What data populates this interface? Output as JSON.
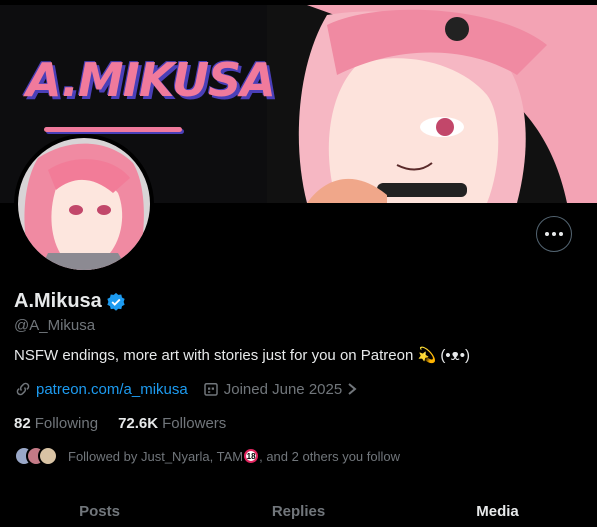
{
  "banner": {
    "logo_text": "A.MIKUSA"
  },
  "profile": {
    "display_name": "A.Mikusa",
    "handle": "@A_Mikusa",
    "bio": "NSFW endings, more art with stories  just for you on Patreon 💫 (•ᴥ•)",
    "link": "patreon.com/a_mikusa",
    "joined": "Joined June 2025",
    "following_count": "82",
    "following_label": "Following",
    "followers_count": "72.6K",
    "followers_label": "Followers",
    "followed_by_prefix": "Followed by Just_Nyarla, TAM",
    "followed_by_badge": "18",
    "followed_by_suffix": ", and 2 others you follow"
  },
  "tabs": [
    {
      "label": "Posts",
      "active": false
    },
    {
      "label": "Replies",
      "active": false
    },
    {
      "label": "Media",
      "active": true
    }
  ],
  "colors": {
    "accent": "#1d9bf0",
    "muted": "#71767b",
    "text": "#e7e9ea",
    "logo_pink": "#f07a9c",
    "logo_shadow": "#4a3fb8"
  },
  "icons": [
    "more-icon",
    "verified-icon",
    "link-icon",
    "calendar-icon",
    "chevron-right-icon"
  ]
}
